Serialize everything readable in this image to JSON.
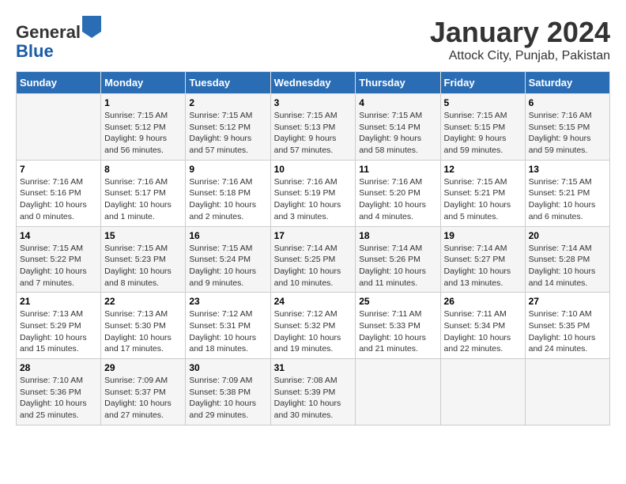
{
  "logo": {
    "general": "General",
    "blue": "Blue"
  },
  "header": {
    "title": "January 2024",
    "subtitle": "Attock City, Punjab, Pakistan"
  },
  "days_of_week": [
    "Sunday",
    "Monday",
    "Tuesday",
    "Wednesday",
    "Thursday",
    "Friday",
    "Saturday"
  ],
  "weeks": [
    [
      {
        "day": "",
        "info": ""
      },
      {
        "day": "1",
        "info": "Sunrise: 7:15 AM\nSunset: 5:12 PM\nDaylight: 9 hours\nand 56 minutes."
      },
      {
        "day": "2",
        "info": "Sunrise: 7:15 AM\nSunset: 5:12 PM\nDaylight: 9 hours\nand 57 minutes."
      },
      {
        "day": "3",
        "info": "Sunrise: 7:15 AM\nSunset: 5:13 PM\nDaylight: 9 hours\nand 57 minutes."
      },
      {
        "day": "4",
        "info": "Sunrise: 7:15 AM\nSunset: 5:14 PM\nDaylight: 9 hours\nand 58 minutes."
      },
      {
        "day": "5",
        "info": "Sunrise: 7:15 AM\nSunset: 5:15 PM\nDaylight: 9 hours\nand 59 minutes."
      },
      {
        "day": "6",
        "info": "Sunrise: 7:16 AM\nSunset: 5:15 PM\nDaylight: 9 hours\nand 59 minutes."
      }
    ],
    [
      {
        "day": "7",
        "info": "Sunrise: 7:16 AM\nSunset: 5:16 PM\nDaylight: 10 hours\nand 0 minutes."
      },
      {
        "day": "8",
        "info": "Sunrise: 7:16 AM\nSunset: 5:17 PM\nDaylight: 10 hours\nand 1 minute."
      },
      {
        "day": "9",
        "info": "Sunrise: 7:16 AM\nSunset: 5:18 PM\nDaylight: 10 hours\nand 2 minutes."
      },
      {
        "day": "10",
        "info": "Sunrise: 7:16 AM\nSunset: 5:19 PM\nDaylight: 10 hours\nand 3 minutes."
      },
      {
        "day": "11",
        "info": "Sunrise: 7:16 AM\nSunset: 5:20 PM\nDaylight: 10 hours\nand 4 minutes."
      },
      {
        "day": "12",
        "info": "Sunrise: 7:15 AM\nSunset: 5:21 PM\nDaylight: 10 hours\nand 5 minutes."
      },
      {
        "day": "13",
        "info": "Sunrise: 7:15 AM\nSunset: 5:21 PM\nDaylight: 10 hours\nand 6 minutes."
      }
    ],
    [
      {
        "day": "14",
        "info": "Sunrise: 7:15 AM\nSunset: 5:22 PM\nDaylight: 10 hours\nand 7 minutes."
      },
      {
        "day": "15",
        "info": "Sunrise: 7:15 AM\nSunset: 5:23 PM\nDaylight: 10 hours\nand 8 minutes."
      },
      {
        "day": "16",
        "info": "Sunrise: 7:15 AM\nSunset: 5:24 PM\nDaylight: 10 hours\nand 9 minutes."
      },
      {
        "day": "17",
        "info": "Sunrise: 7:14 AM\nSunset: 5:25 PM\nDaylight: 10 hours\nand 10 minutes."
      },
      {
        "day": "18",
        "info": "Sunrise: 7:14 AM\nSunset: 5:26 PM\nDaylight: 10 hours\nand 11 minutes."
      },
      {
        "day": "19",
        "info": "Sunrise: 7:14 AM\nSunset: 5:27 PM\nDaylight: 10 hours\nand 13 minutes."
      },
      {
        "day": "20",
        "info": "Sunrise: 7:14 AM\nSunset: 5:28 PM\nDaylight: 10 hours\nand 14 minutes."
      }
    ],
    [
      {
        "day": "21",
        "info": "Sunrise: 7:13 AM\nSunset: 5:29 PM\nDaylight: 10 hours\nand 15 minutes."
      },
      {
        "day": "22",
        "info": "Sunrise: 7:13 AM\nSunset: 5:30 PM\nDaylight: 10 hours\nand 17 minutes."
      },
      {
        "day": "23",
        "info": "Sunrise: 7:12 AM\nSunset: 5:31 PM\nDaylight: 10 hours\nand 18 minutes."
      },
      {
        "day": "24",
        "info": "Sunrise: 7:12 AM\nSunset: 5:32 PM\nDaylight: 10 hours\nand 19 minutes."
      },
      {
        "day": "25",
        "info": "Sunrise: 7:11 AM\nSunset: 5:33 PM\nDaylight: 10 hours\nand 21 minutes."
      },
      {
        "day": "26",
        "info": "Sunrise: 7:11 AM\nSunset: 5:34 PM\nDaylight: 10 hours\nand 22 minutes."
      },
      {
        "day": "27",
        "info": "Sunrise: 7:10 AM\nSunset: 5:35 PM\nDaylight: 10 hours\nand 24 minutes."
      }
    ],
    [
      {
        "day": "28",
        "info": "Sunrise: 7:10 AM\nSunset: 5:36 PM\nDaylight: 10 hours\nand 25 minutes."
      },
      {
        "day": "29",
        "info": "Sunrise: 7:09 AM\nSunset: 5:37 PM\nDaylight: 10 hours\nand 27 minutes."
      },
      {
        "day": "30",
        "info": "Sunrise: 7:09 AM\nSunset: 5:38 PM\nDaylight: 10 hours\nand 29 minutes."
      },
      {
        "day": "31",
        "info": "Sunrise: 7:08 AM\nSunset: 5:39 PM\nDaylight: 10 hours\nand 30 minutes."
      },
      {
        "day": "",
        "info": ""
      },
      {
        "day": "",
        "info": ""
      },
      {
        "day": "",
        "info": ""
      }
    ]
  ]
}
